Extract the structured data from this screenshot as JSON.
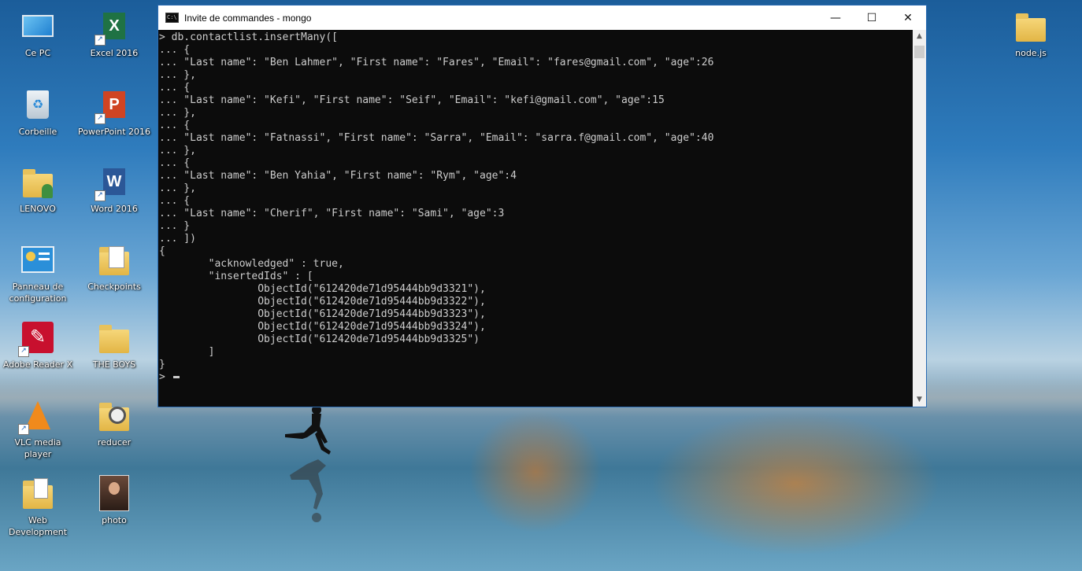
{
  "desktop": {
    "icons": [
      {
        "label": "Ce PC"
      },
      {
        "label": "Excel 2016"
      },
      {
        "label": "Corbeille"
      },
      {
        "label": "PowerPoint 2016"
      },
      {
        "label": "LENOVO"
      },
      {
        "label": "Word 2016"
      },
      {
        "label": "Panneau de configuration"
      },
      {
        "label": "Checkpoints"
      },
      {
        "label": "Adobe Reader X"
      },
      {
        "label": "THE BOYS"
      },
      {
        "label": "VLC media player"
      },
      {
        "label": "reducer"
      },
      {
        "label": "Web Development"
      },
      {
        "label": "photo"
      },
      {
        "label": "node.js"
      }
    ]
  },
  "window": {
    "title": "Invite de commandes - mongo",
    "controls": {
      "minimize": "—",
      "maximize": "☐",
      "close": "✕"
    }
  },
  "console": {
    "lines": [
      "> db.contactlist.insertMany([",
      "... {",
      "... \"Last name\": \"Ben Lahmer\", \"First name\": \"Fares\", \"Email\": \"fares@gmail.com\", \"age\":26",
      "... },",
      "... {",
      "... \"Last name\": \"Kefi\", \"First name\": \"Seif\", \"Email\": \"kefi@gmail.com\", \"age\":15",
      "... },",
      "... {",
      "... \"Last name\": \"Fatnassi\", \"First name\": \"Sarra\", \"Email\": \"sarra.f@gmail.com\", \"age\":40",
      "... },",
      "... {",
      "... \"Last name\": \"Ben Yahia\", \"First name\": \"Rym\", \"age\":4",
      "... },",
      "... {",
      "... \"Last name\": \"Cherif\", \"First name\": \"Sami\", \"age\":3",
      "... }",
      "... ])",
      "{",
      "        \"acknowledged\" : true,",
      "        \"insertedIds\" : [",
      "                ObjectId(\"612420de71d95444bb9d3321\"),",
      "                ObjectId(\"612420de71d95444bb9d3322\"),",
      "                ObjectId(\"612420de71d95444bb9d3323\"),",
      "                ObjectId(\"612420de71d95444bb9d3324\"),",
      "                ObjectId(\"612420de71d95444bb9d3325\")",
      "        ]",
      "}"
    ],
    "prompt": "> "
  }
}
